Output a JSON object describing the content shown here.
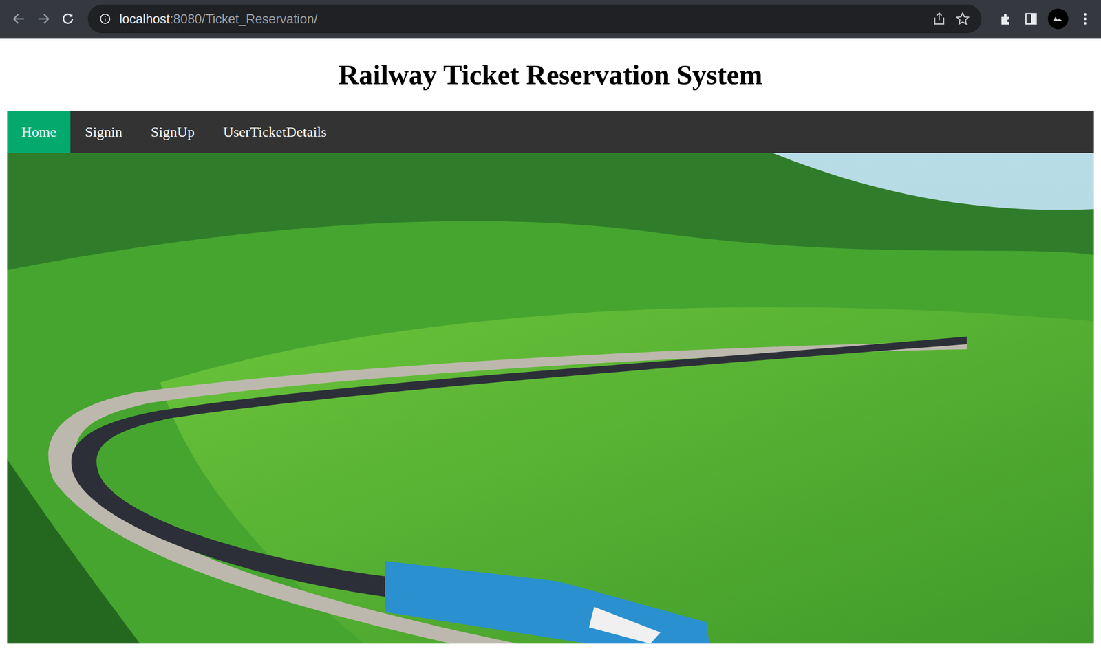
{
  "browser": {
    "url_host": "localhost",
    "url_path": ":8080/Ticket_Reservation/"
  },
  "page": {
    "title": "Railway Ticket Reservation System"
  },
  "nav": [
    {
      "label": "Home",
      "selected": true
    },
    {
      "label": "Signin",
      "selected": false
    },
    {
      "label": "SignUp",
      "selected": false
    },
    {
      "label": "UserTicketDetails",
      "selected": false
    }
  ]
}
